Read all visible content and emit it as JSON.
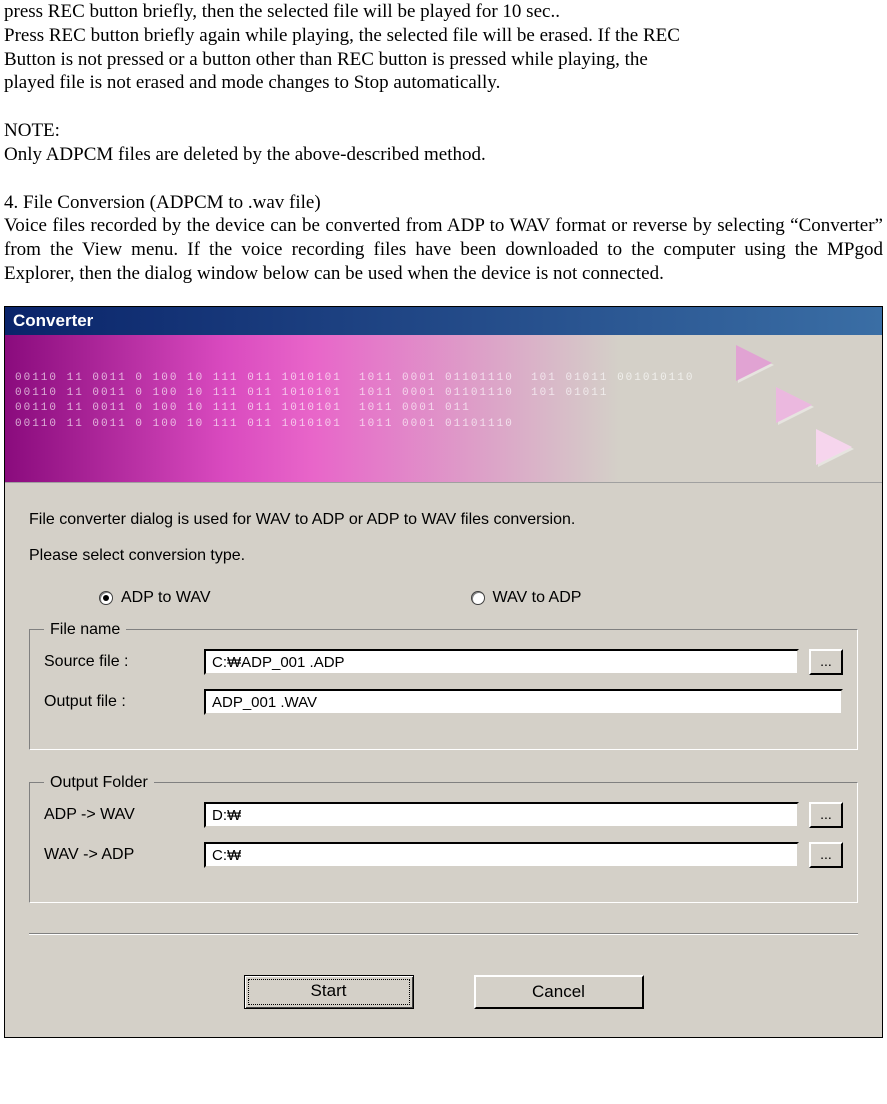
{
  "doc": {
    "p1": "press REC button briefly, then the selected file will be played for 10 sec..",
    "p2": "Press REC button briefly again while playing, the selected file will be erased. If the REC",
    "p3": "Button is not pressed or a button other than REC button is pressed while playing, the",
    "p4": "played file is not erased and mode changes to Stop automatically.",
    "note_head": "NOTE:",
    "note_body": "Only ADPCM files are deleted by the above-described method.",
    "sec_head": "4. File Conversion (ADPCM to .wav file)",
    "sec_body": "Voice files recorded by the device can be converted from ADP to WAV format or reverse by selecting “Converter” from the View menu. If the voice recording files have been downloaded to the computer using the MPgod Explorer, then the dialog window below can be used when the device is not connected."
  },
  "dialog": {
    "title": "Converter",
    "desc1": "File converter dialog is used for WAV to ADP or ADP to WAV files conversion.",
    "desc2": "Please select conversion type.",
    "radio1": "ADP to WAV",
    "radio2": "WAV to ADP",
    "group_file": "File name",
    "label_source": "Source file :",
    "label_output": "Output file  :",
    "value_source": "C:₩ADP_001 .ADP",
    "value_output": "ADP_001 .WAV",
    "group_folder": "Output Folder",
    "label_adp_wav": "ADP -> WAV",
    "label_wav_adp": "WAV -> ADP",
    "value_folder1": "D:₩",
    "value_folder2": "C:₩",
    "browse": "...",
    "start": "Start",
    "cancel": "Cancel"
  },
  "banner": {
    "bits": "00110 11 0011 0 100 10 111 011 1010101  1011 0001 01101110  101 01011 001010110\n00110 11 0011 0 100 10 111 011 1010101  1011 0001 01101110  101 01011\n00110 11 0011 0 100 10 111 011 1010101  1011 0001 011\n00110 11 0011 0 100 10 111 011 1010101  1011 0001 01101110"
  }
}
